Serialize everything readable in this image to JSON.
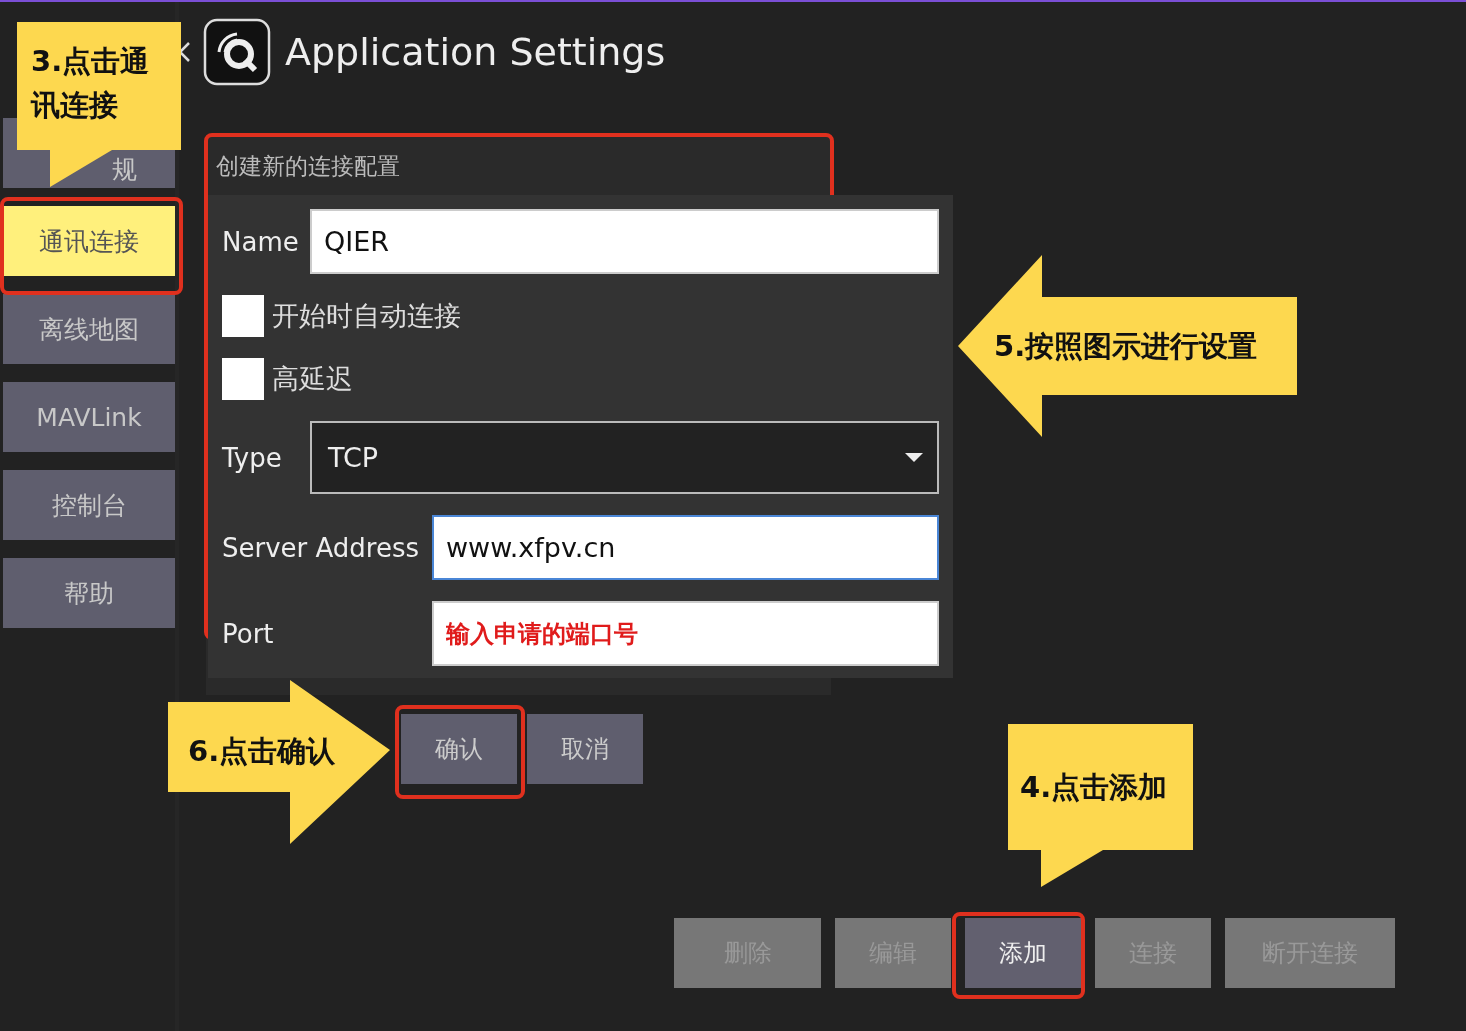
{
  "header": {
    "title": "Application Settings"
  },
  "sidebar": {
    "items": [
      {
        "label": "规",
        "selected": false
      },
      {
        "label": "通讯连接",
        "selected": true
      },
      {
        "label": "离线地图",
        "selected": false
      },
      {
        "label": "MAVLink",
        "selected": false
      },
      {
        "label": "控制台",
        "selected": false
      },
      {
        "label": "帮助",
        "selected": false
      }
    ]
  },
  "panel": {
    "title": "创建新的连接配置"
  },
  "dialog": {
    "fields": [
      {
        "kind": "text",
        "label": "Name",
        "value": "QIER",
        "focused": false,
        "highlighted": false
      },
      {
        "kind": "checkbox",
        "label": "开始时自动连接",
        "checked": false
      },
      {
        "kind": "checkbox",
        "label": "高延迟",
        "checked": false
      },
      {
        "kind": "dropdown",
        "label": "Type",
        "value": "TCP"
      },
      {
        "kind": "text",
        "label": "Server Address",
        "value": "www.xfpv.cn",
        "focused": true,
        "highlighted": false
      },
      {
        "kind": "text",
        "label": "Port",
        "value": "输入申请的端口号",
        "focused": false,
        "highlighted": true
      }
    ],
    "buttons": [
      {
        "label": "确认"
      },
      {
        "label": "取消"
      }
    ]
  },
  "actions": [
    {
      "label": "删除",
      "disabled": true
    },
    {
      "label": "编辑",
      "disabled": true
    },
    {
      "label": "添加",
      "disabled": false
    },
    {
      "label": "连接",
      "disabled": true
    },
    {
      "label": "断开连接",
      "disabled": true
    }
  ],
  "annotations": [
    {
      "kind": "down",
      "text": "3.点击通讯连接"
    },
    {
      "kind": "left",
      "text": "5.按照图示进行设置"
    },
    {
      "kind": "right",
      "text": "6.点击确认"
    },
    {
      "kind": "down",
      "text": "4.点击添加"
    }
  ]
}
